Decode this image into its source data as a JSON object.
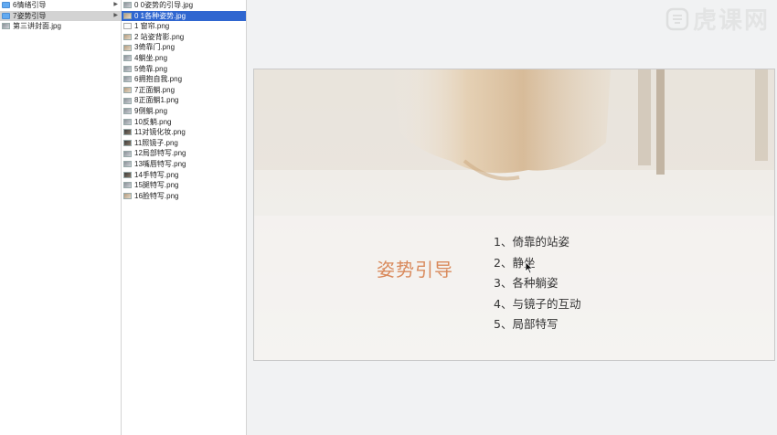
{
  "finder": {
    "column1": [
      {
        "label": "6情绪引导",
        "type": "folder",
        "state": "normal",
        "has_children": true
      },
      {
        "label": "7姿势引导",
        "type": "folder",
        "state": "highlighted",
        "has_children": true
      },
      {
        "label": "第三讲封面.jpg",
        "type": "image",
        "state": "normal",
        "has_children": false
      }
    ],
    "column2": [
      {
        "label": "0 0姿势的引导.jpg",
        "icon": "img",
        "state": "normal"
      },
      {
        "label": "0 1各种姿势.jpg",
        "icon": "warm",
        "state": "selected"
      },
      {
        "label": "1 窗帘.png",
        "icon": "doc",
        "state": "normal"
      },
      {
        "label": "2 站姿背影.png",
        "icon": "warm",
        "state": "normal"
      },
      {
        "label": "3倚靠门.png",
        "icon": "warm",
        "state": "normal"
      },
      {
        "label": "4躺坐.png",
        "icon": "img",
        "state": "normal"
      },
      {
        "label": "5倚靠.png",
        "icon": "img",
        "state": "normal"
      },
      {
        "label": "6拥抱自我.png",
        "icon": "img",
        "state": "normal"
      },
      {
        "label": "7正面躺.png",
        "icon": "warm",
        "state": "normal"
      },
      {
        "label": "8正面躺1.png",
        "icon": "img",
        "state": "normal"
      },
      {
        "label": "9侧躺.png",
        "icon": "img",
        "state": "normal"
      },
      {
        "label": "10反躺.png",
        "icon": "img",
        "state": "normal"
      },
      {
        "label": "11对镜化妆.png",
        "icon": "dark",
        "state": "normal"
      },
      {
        "label": "11照镜子.png",
        "icon": "dark",
        "state": "normal"
      },
      {
        "label": "12局部特写.png",
        "icon": "img",
        "state": "normal"
      },
      {
        "label": "13嘴唇特写.png",
        "icon": "img",
        "state": "normal"
      },
      {
        "label": "14手特写.png",
        "icon": "dark",
        "state": "normal"
      },
      {
        "label": "15腿特写.png",
        "icon": "img",
        "state": "normal"
      },
      {
        "label": "16脸特写.png",
        "icon": "warm",
        "state": "normal"
      }
    ]
  },
  "preview": {
    "title": "姿势引导",
    "items": [
      "1、倚靠的站姿",
      "2、静坐",
      "3、各种躺姿",
      "4、与镜子的互动",
      "5、局部特写"
    ]
  },
  "watermark": {
    "text": "虎课网"
  },
  "colors": {
    "selection": "#2f66d0",
    "folder": "#62aaf1",
    "slide_title": "#d98a5c"
  }
}
